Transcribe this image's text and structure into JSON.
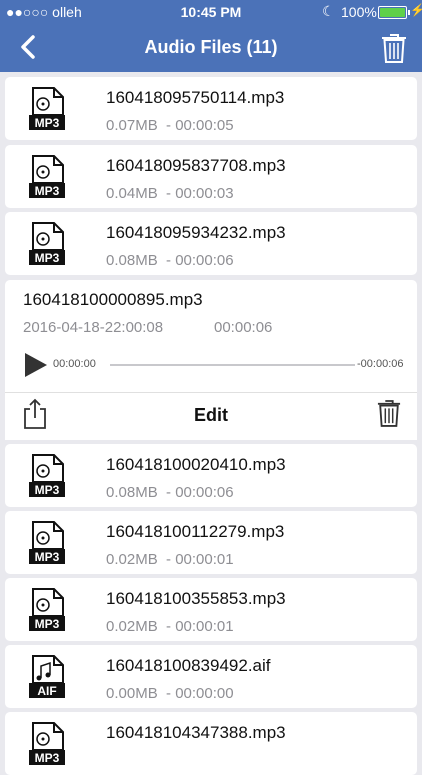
{
  "status_bar": {
    "carrier": "●●○○○ olleh",
    "time": "10:45 PM",
    "battery_percent": "100%",
    "battery_color": "#5fd04a"
  },
  "nav": {
    "title": "Audio Files (11)",
    "bar_color": "#4b72b8"
  },
  "files": [
    {
      "name": "160418095750114.mp3",
      "meta": "0.07MB  - 00:00:05",
      "type": "MP3"
    },
    {
      "name": "160418095837708.mp3",
      "meta": "0.04MB  - 00:00:03",
      "type": "MP3"
    },
    {
      "name": "160418095934232.mp3",
      "meta": "0.08MB  - 00:00:06",
      "type": "MP3"
    }
  ],
  "expanded": {
    "name": "160418100000895.mp3",
    "date": "2016-04-18-22:00:08",
    "duration": "00:00:06",
    "elapsed": "00:00:00",
    "remaining": "-00:00:06",
    "progress": 0,
    "edit_label": "Edit"
  },
  "files_after": [
    {
      "name": "160418100020410.mp3",
      "meta": "0.08MB  - 00:00:06",
      "type": "MP3"
    },
    {
      "name": "160418100112279.mp3",
      "meta": "0.02MB  - 00:00:01",
      "type": "MP3"
    },
    {
      "name": "160418100355853.mp3",
      "meta": "0.02MB  - 00:00:01",
      "type": "MP3"
    },
    {
      "name": "160418100839492.aif",
      "meta": "0.00MB  - 00:00:00",
      "type": "AIF"
    },
    {
      "name": "160418104347388.mp3",
      "meta": "",
      "type": "MP3"
    }
  ]
}
